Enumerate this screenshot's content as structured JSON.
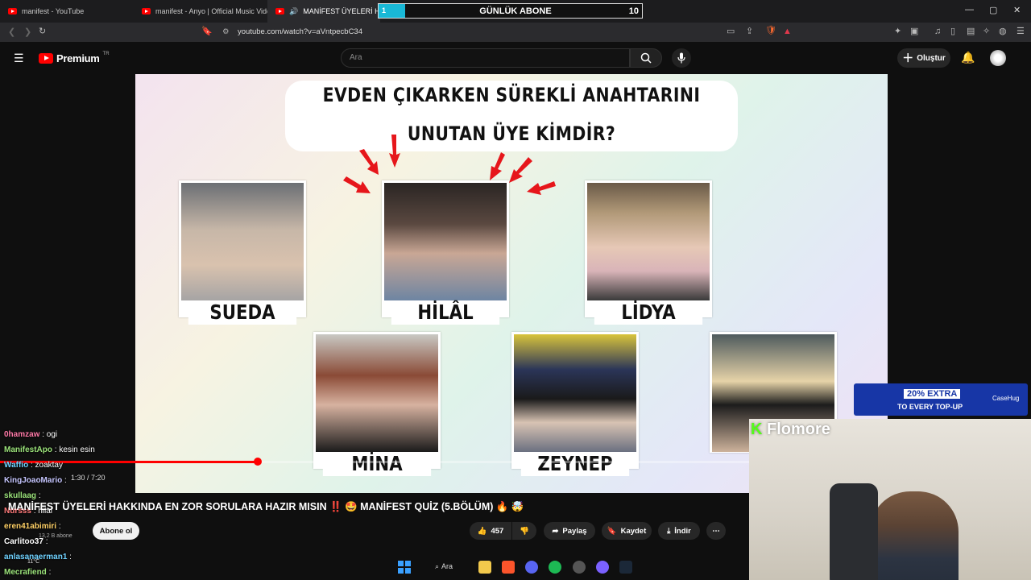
{
  "browser": {
    "tabs": [
      {
        "title": "manifest - YouTube"
      },
      {
        "title": "manifest - Anyo | Official Music Video"
      },
      {
        "title": "MANİFEST ÜYELERİ HAKKINDA"
      }
    ],
    "url": "youtube.com/watch?v=aVntpecbC34"
  },
  "overlay": {
    "counter_label": "GÜNLÜK ABONE",
    "counter_value": "10",
    "counter_fill": "1"
  },
  "youtube": {
    "logo": "Premium",
    "region": "TR",
    "search_placeholder": "Ara",
    "create_label": "Oluştur"
  },
  "video": {
    "question_line1": "EVDEN ÇIKARKEN SÜREKLİ ANAHTARINI",
    "question_line2": "UNUTAN ÜYE KİMDİR?",
    "members": [
      "SUEDA",
      "HİLÂL",
      "LİDYA",
      "MİNA",
      "ZEYNEP"
    ],
    "time": "1:30 / 7:20",
    "progress_fraction": 0.344,
    "title": "MANİFEST ÜYELERİ HAKKINDA EN ZOR SORULARA HAZIR MISIN ‼️ 🤩 MANİFEST QUİZ (5.BÖLÜM) 🔥 🤯"
  },
  "actions": {
    "subscribe": "Abone ol",
    "subscribers": "13,2 B abone",
    "likes": "457",
    "share": "Paylaş",
    "save": "Kaydet",
    "download": "İndir"
  },
  "chat": [
    {
      "user": "0hamzaw",
      "msg": ": ogi",
      "color": "#ff7aa8"
    },
    {
      "user": "ManifestApo",
      "msg": ": kesin esin",
      "color": "#9be37a"
    },
    {
      "user": "Waffio",
      "msg": ": zoaktay",
      "color": "#6fd2ff"
    },
    {
      "user": "KingJoaoMario",
      "msg": ":",
      "color": "#c6c6ff"
    },
    {
      "user": "skullaag",
      "msg": ":",
      "color": "#9be37a"
    },
    {
      "user": "Nursss",
      "msg": ": hilal",
      "color": "#ff7a7a"
    },
    {
      "user": "eren41abimiri",
      "msg": ":",
      "color": "#ffd166"
    },
    {
      "user": "Carlitoo37",
      "msg": ":",
      "color": "#ffffff"
    },
    {
      "user": "anlasanaerman1",
      "msg": ":",
      "color": "#6fd2ff"
    },
    {
      "user": "Mecrafiend",
      "msg": ":",
      "color": "#9be37a"
    }
  ],
  "stream": {
    "name": "Flomore",
    "promo_line1": "20% EXTRA",
    "promo_line2": "TO EVERY TOP-UP",
    "promo_brand": "CaseHug",
    "weather": "11°C"
  },
  "taskbar": {
    "search": "Ara"
  }
}
